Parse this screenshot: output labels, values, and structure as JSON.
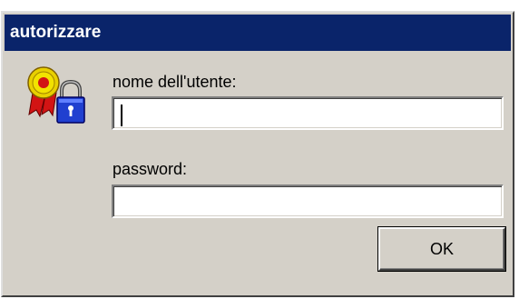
{
  "window": {
    "title": "autorizzare"
  },
  "form": {
    "username_label": "nome dell'utente:",
    "username_value": "",
    "password_label": "password:",
    "password_value": ""
  },
  "buttons": {
    "ok_label": "OK"
  },
  "icons": {
    "main": "ribbon-lock-icon"
  },
  "colors": {
    "titlebar": "#0a246a",
    "dialog_face": "#d4d0c8"
  }
}
